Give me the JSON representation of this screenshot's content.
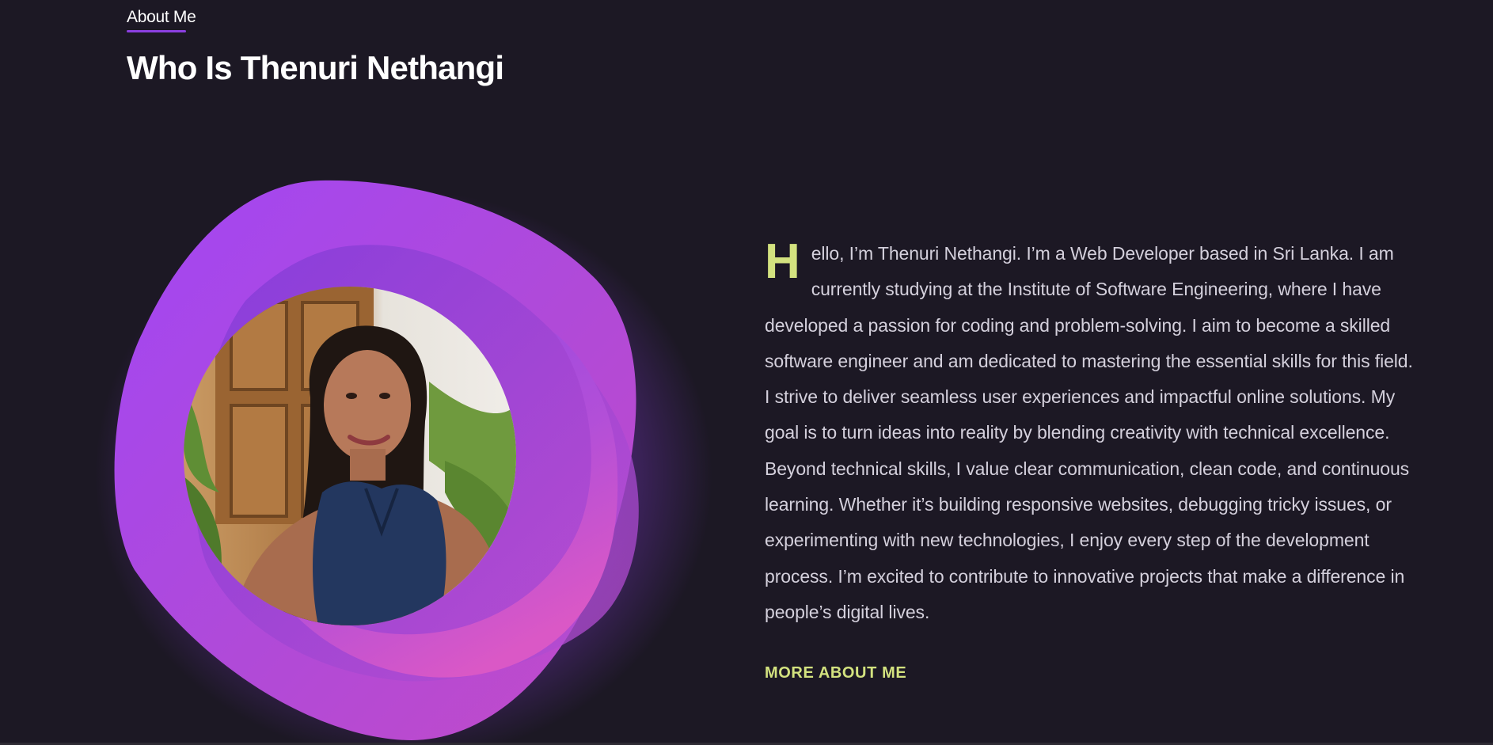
{
  "section": {
    "tag": "About Me",
    "title": "Who Is Thenuri Nethangi"
  },
  "bio": {
    "dropcap": "H",
    "text": "ello, I’m Thenuri Nethangi. I’m a Web Developer based in Sri Lanka. I am currently studying at the Institute of Software Engineering, where I have developed a passion for coding and problem-solving. I aim to become a skilled software engineer and am dedicated to mastering the essential skills for this field. I strive to deliver seamless user experiences and impactful online solutions. My goal is to turn ideas into reality by blending creativity with technical excellence. Beyond technical skills, I value clear communication, clean code, and continuous learning. Whether it’s building responsive websites, debugging tricky issues, or experimenting with new technologies, I enjoy every step of the development process. I’m excited to contribute to innovative projects that make a difference in people’s digital lives."
  },
  "cta": {
    "label": "MORE ABOUT ME"
  },
  "colors": {
    "background": "#1c1824",
    "accent_purple": "#8b3fe0",
    "accent_lime": "#d3e27f",
    "blob_gradient": [
      "#a44af0",
      "#c84fd4",
      "#d958c8"
    ]
  }
}
